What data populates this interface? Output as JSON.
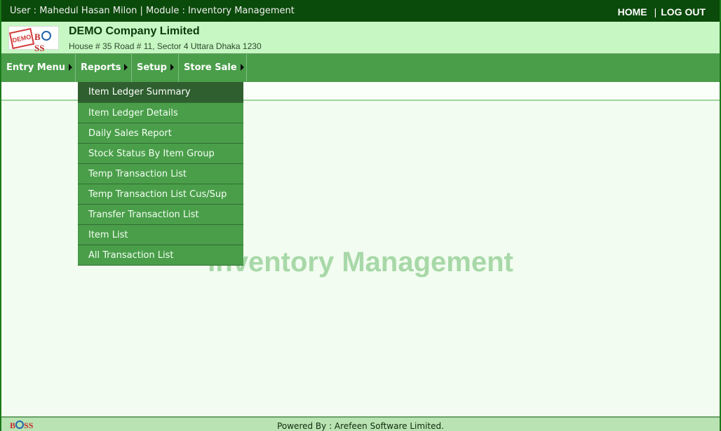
{
  "topbar": {
    "user_text": "User : Mahedul Hasan Milon  | Module : Inventory Management",
    "home_label": "HOME",
    "separator": "|",
    "logout_label": "LOG OUT"
  },
  "company": {
    "logo_demo": "DEMO",
    "logo_boss": "BOSS",
    "name": "DEMO Company Limited",
    "address": "House # 35 Road # 11, Sector 4 Uttara Dhaka 1230"
  },
  "menu": {
    "items": [
      {
        "label": "Entry Menu"
      },
      {
        "label": "Reports"
      },
      {
        "label": "Setup"
      },
      {
        "label": "Store Sale"
      }
    ]
  },
  "reports_dropdown": {
    "items": [
      {
        "label": "Item Ledger Summary"
      },
      {
        "label": "Item Ledger Details"
      },
      {
        "label": "Daily Sales Report"
      },
      {
        "label": "Stock Status By Item Group"
      },
      {
        "label": "Temp Transaction List"
      },
      {
        "label": "Temp Transaction List Cus/Sup"
      },
      {
        "label": "Transfer Transaction List"
      },
      {
        "label": "Item List"
      },
      {
        "label": "All Transaction List"
      }
    ]
  },
  "main": {
    "watermark": "Inventory Management"
  },
  "footer": {
    "logo": "BOSS",
    "powered_by": "Powered By : Arefeen Software Limited."
  },
  "colors": {
    "topbar": "#0a4a0a",
    "company_band": "#c7f7c2",
    "menubar": "#4a9e4a",
    "dropdown_active": "#2f5f2f",
    "watermark": "#a8d8a8"
  }
}
